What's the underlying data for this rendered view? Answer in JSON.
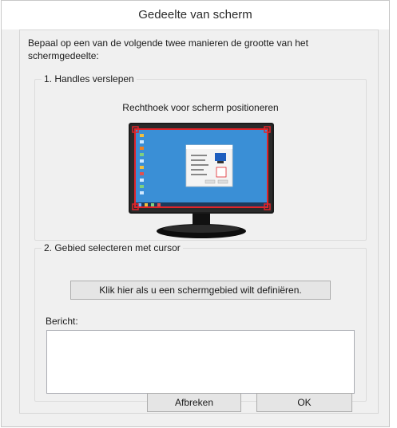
{
  "window": {
    "title": "Gedeelte van scherm"
  },
  "intro": "Bepaal op een van de volgende twee manieren de grootte van het schermgedeelte:",
  "group1": {
    "legend": "1. Handles verslepen",
    "caption": "Rechthoek voor scherm positioneren",
    "selection_color": "#e0242a",
    "screen_color": "#3a8fd6"
  },
  "group2": {
    "legend": "2. Gebied selecteren met cursor",
    "define_button": "Klik hier als u een schermgebied wilt definiëren.",
    "message_label": "Bericht:",
    "message_value": ""
  },
  "buttons": {
    "cancel": "Afbreken",
    "ok": "OK"
  }
}
